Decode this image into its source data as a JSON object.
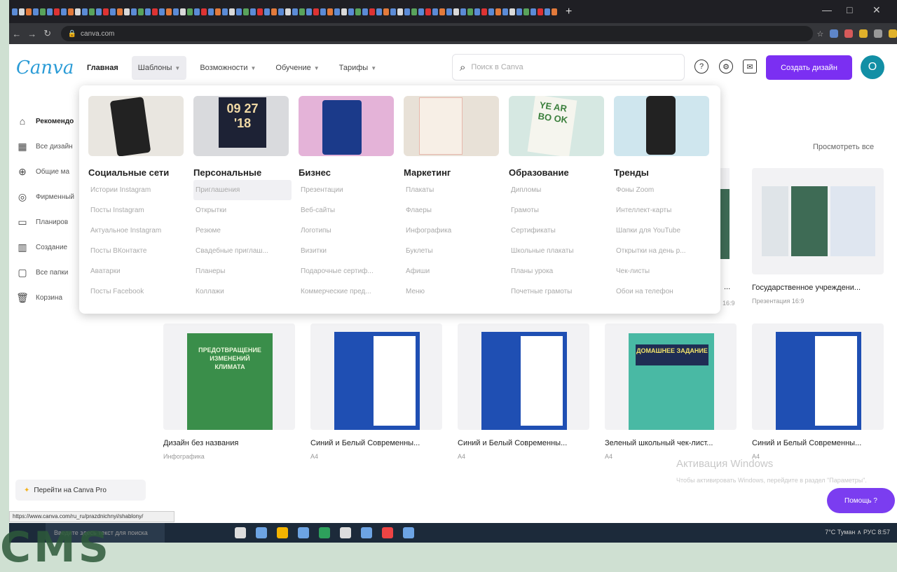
{
  "browser": {
    "url": "canva.com",
    "new_tab": "+",
    "window_controls": [
      "—",
      "□",
      "✕"
    ]
  },
  "header": {
    "logo": "Canva",
    "nav": [
      {
        "label": "Главная"
      },
      {
        "label": "Шаблоны"
      },
      {
        "label": "Возможности"
      },
      {
        "label": "Обучение"
      },
      {
        "label": "Тарифы"
      }
    ],
    "search_placeholder": "Поиск в Canva",
    "create_button": "Создать дизайн",
    "avatar_initial": "O"
  },
  "sidebar": {
    "items": [
      {
        "label": "Рекомендо",
        "icon": "home-icon"
      },
      {
        "label": "Все дизайн",
        "icon": "grid-icon"
      },
      {
        "label": "Общие ма",
        "icon": "share-icon"
      },
      {
        "label": "Фирменный",
        "icon": "brand-icon"
      },
      {
        "label": "Планиров",
        "icon": "calendar-icon"
      },
      {
        "label": "Создание",
        "icon": "building-icon"
      },
      {
        "label": "Все папки",
        "icon": "folder-icon"
      },
      {
        "label": "Корзина",
        "icon": "trash-icon"
      }
    ]
  },
  "megamenu": {
    "columns": [
      {
        "title": "Социальные сети",
        "links": [
          "Истории Instagram",
          "Посты Instagram",
          "Актуальное Instagram",
          "Посты ВКонтакте",
          "Аватарки",
          "Посты Facebook"
        ]
      },
      {
        "title": "Персональные",
        "links": [
          "Приглашения",
          "Открытки",
          "Резюме",
          "Свадебные приглаш...",
          "Планеры",
          "Коллажи"
        ]
      },
      {
        "title": "Бизнес",
        "links": [
          "Презентации",
          "Веб-сайты",
          "Логотипы",
          "Визитки",
          "Подарочные сертиф...",
          "Коммерческие пред..."
        ]
      },
      {
        "title": "Маркетинг",
        "links": [
          "Плакаты",
          "Флаеры",
          "Инфографика",
          "Буклеты",
          "Афиши",
          "Меню"
        ]
      },
      {
        "title": "Образование",
        "links": [
          "Дипломы",
          "Грамоты",
          "Сертификаты",
          "Школьные плакаты",
          "Планы урока",
          "Почетные грамоты"
        ]
      },
      {
        "title": "Тренды",
        "links": [
          "Фоны Zoom",
          "Интеллект-карты",
          "Шапки для YouTube",
          "Открытки на день р...",
          "Чек-листы",
          "Обои на телефон"
        ]
      }
    ],
    "thumb_texts": {
      "date_card": "09 27 '18",
      "yearbook": "YE AR BO OK"
    }
  },
  "main": {
    "view_all": "Просмотреть все",
    "top_card": {
      "title": "Государственное учреждени...",
      "subtitle": "Презентация 16:9"
    },
    "cut_title": "...",
    "cut_subtitle": "16:9",
    "cards": [
      {
        "title": "Дизайн без названия",
        "subtitle": "Инфографика",
        "thumb_text": "ПРЕДОТВРАЩЕНИЕ ИЗМЕНЕНИЙ КЛИМАТА"
      },
      {
        "title": "Синий и Белый Современны...",
        "subtitle": "A4"
      },
      {
        "title": "Синий и Белый Современны...",
        "subtitle": "A4"
      },
      {
        "title": "Зеленый школьный чек-лист...",
        "subtitle": "A4",
        "thumb_text": "ДОМАШНЕЕ ЗАДАНИЕ"
      },
      {
        "title": "Синий и Белый Современны...",
        "subtitle": "A4"
      }
    ],
    "pro_button": "Перейти на Canva Pro",
    "help_button": "Помощь ?"
  },
  "windows": {
    "activation_title": "Активация Windows",
    "activation_text": "Чтобы активировать Windows, перейдите в раздел \"Параметры\".",
    "status_url": "https://www.canva.com/ru_ru/prazdnichnyi/shablony/",
    "taskbar_search": "Введите здесь текст для поиска",
    "tray": "7°C Туман  ∧  РУС  8:57",
    "big_text": "CMS"
  },
  "colors": {
    "accent": "#7b2ff2",
    "logo": "#2a9bd6",
    "avatar": "#128fa5"
  }
}
